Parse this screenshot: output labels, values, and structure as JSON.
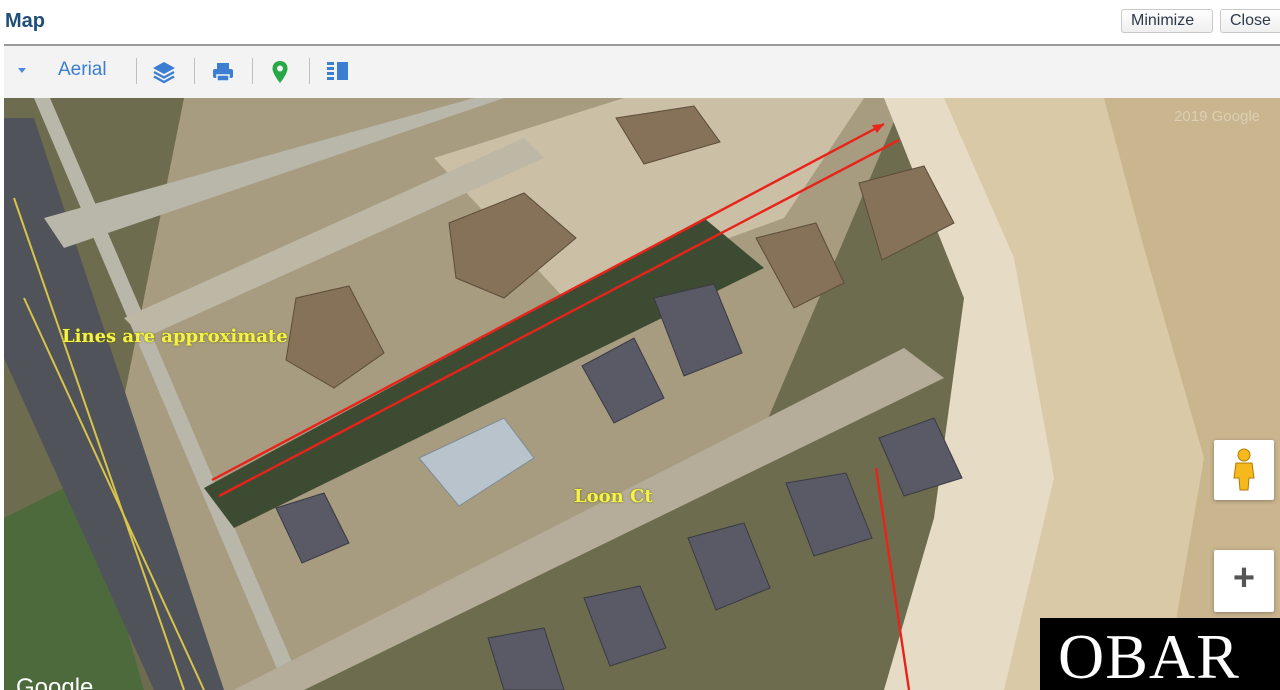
{
  "header": {
    "title": "Map",
    "minimize_label": "Minimize",
    "close_label": "Close"
  },
  "toolbar": {
    "map_type_label": "Aerial",
    "icons": [
      "chevron-down-icon",
      "layers-icon",
      "print-icon",
      "map-pin-icon",
      "list-view-icon"
    ]
  },
  "map": {
    "annotation": "Lines are approximate",
    "street_label": "Loon Ct",
    "copyright": "2019 Google",
    "attribution": "Google",
    "watermark": "OBAR",
    "zoom_in_symbol": "+"
  },
  "colors": {
    "title": "#1f4e79",
    "accent": "#3b7ed2",
    "pin": "#27a844",
    "annotation_text": "#f5f24a",
    "property_line": "#e8231a"
  }
}
